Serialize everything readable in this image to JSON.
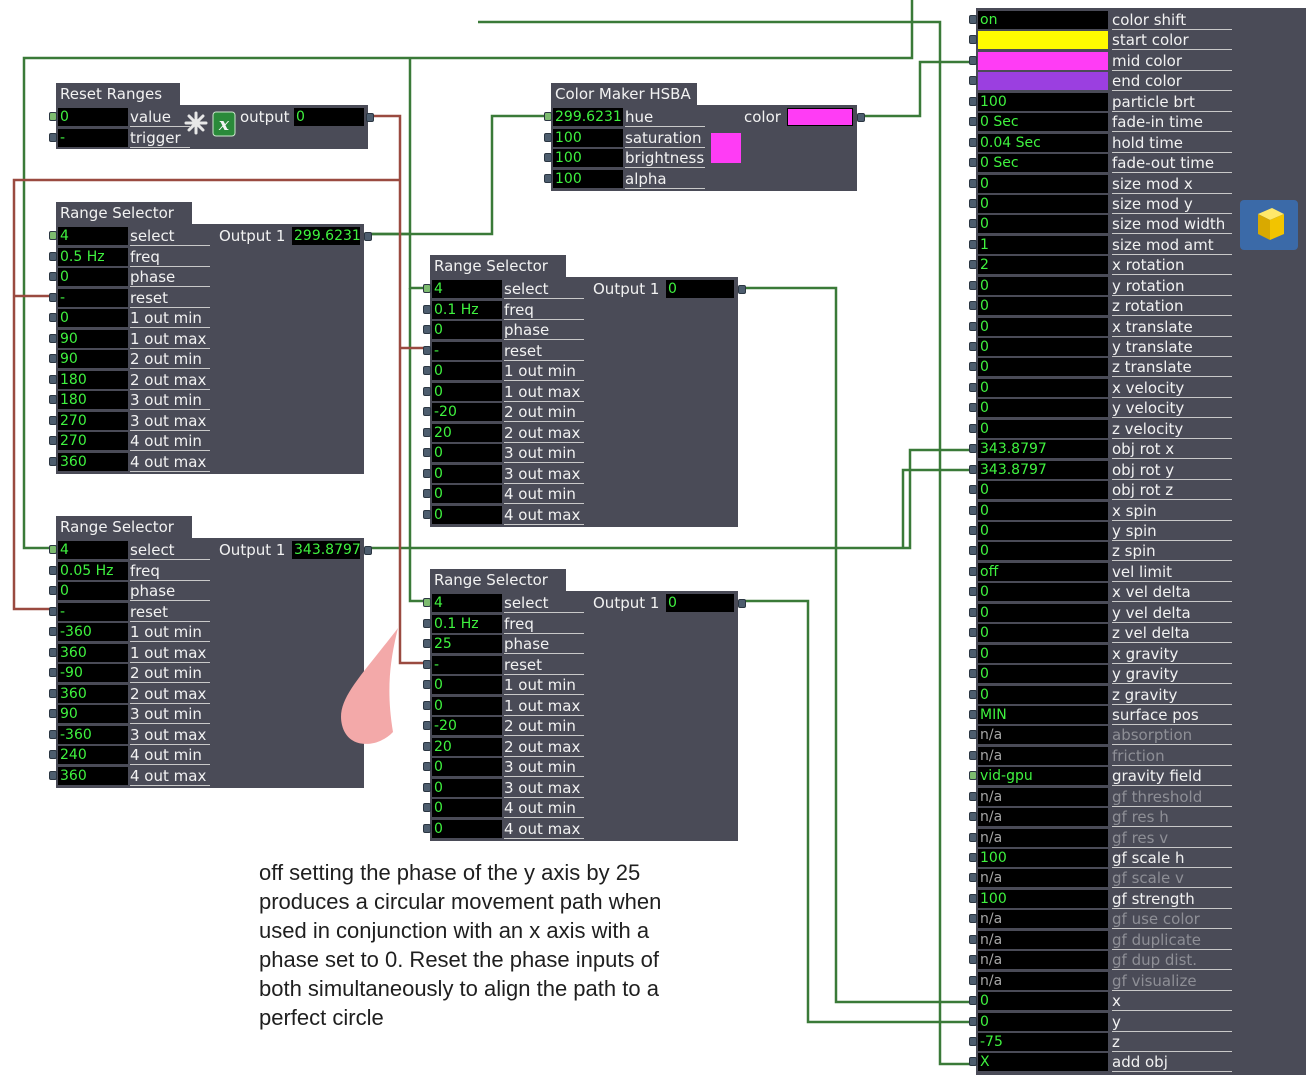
{
  "reset_ranges": {
    "title": "Reset Ranges",
    "inputs": [
      {
        "value": "0",
        "label": "value"
      },
      {
        "value": "-",
        "label": "trigger"
      }
    ],
    "output_label": "output",
    "output_value": "0"
  },
  "color_maker": {
    "title": "Color Maker HSBA",
    "inputs": [
      {
        "value": "299.6231",
        "label": "hue"
      },
      {
        "value": "100",
        "label": "saturation"
      },
      {
        "value": "100",
        "label": "brightness"
      },
      {
        "value": "100",
        "label": "alpha"
      }
    ],
    "output_label": "color",
    "swatch_color": "#ff3cf5"
  },
  "range_selector_1": {
    "title": "Range Selector",
    "output_label": "Output 1",
    "output_value": "299.6231",
    "inputs": [
      {
        "value": "4",
        "label": "select"
      },
      {
        "value": "0.5 Hz",
        "label": "freq"
      },
      {
        "value": "0",
        "label": "phase"
      },
      {
        "value": "-",
        "label": "reset"
      },
      {
        "value": "0",
        "label": "1 out min"
      },
      {
        "value": "90",
        "label": "1 out max"
      },
      {
        "value": "90",
        "label": "2 out min"
      },
      {
        "value": "180",
        "label": "2 out max"
      },
      {
        "value": "180",
        "label": "3 out min"
      },
      {
        "value": "270",
        "label": "3 out max"
      },
      {
        "value": "270",
        "label": "4 out min"
      },
      {
        "value": "360",
        "label": "4 out max"
      }
    ]
  },
  "range_selector_2": {
    "title": "Range Selector",
    "output_label": "Output 1",
    "output_value": "343.8797",
    "inputs": [
      {
        "value": "4",
        "label": "select"
      },
      {
        "value": "0.05 Hz",
        "label": "freq"
      },
      {
        "value": "0",
        "label": "phase"
      },
      {
        "value": "-",
        "label": "reset"
      },
      {
        "value": "-360",
        "label": "1 out min"
      },
      {
        "value": "360",
        "label": "1 out max"
      },
      {
        "value": "-90",
        "label": "2 out min"
      },
      {
        "value": "360",
        "label": "2 out max"
      },
      {
        "value": "90",
        "label": "3 out min"
      },
      {
        "value": "-360",
        "label": "3 out max"
      },
      {
        "value": "240",
        "label": "4 out min"
      },
      {
        "value": "360",
        "label": "4 out max"
      }
    ]
  },
  "range_selector_3": {
    "title": "Range Selector",
    "output_label": "Output 1",
    "output_value": "0",
    "inputs": [
      {
        "value": "4",
        "label": "select"
      },
      {
        "value": "0.1 Hz",
        "label": "freq"
      },
      {
        "value": "0",
        "label": "phase"
      },
      {
        "value": "-",
        "label": "reset"
      },
      {
        "value": "0",
        "label": "1 out min"
      },
      {
        "value": "0",
        "label": "1 out max"
      },
      {
        "value": "-20",
        "label": "2 out min"
      },
      {
        "value": "20",
        "label": "2 out max"
      },
      {
        "value": "0",
        "label": "3 out min"
      },
      {
        "value": "0",
        "label": "3 out max"
      },
      {
        "value": "0",
        "label": "4 out min"
      },
      {
        "value": "0",
        "label": "4 out max"
      }
    ]
  },
  "range_selector_4": {
    "title": "Range Selector",
    "output_label": "Output 1",
    "output_value": "0",
    "inputs": [
      {
        "value": "4",
        "label": "select"
      },
      {
        "value": "0.1 Hz",
        "label": "freq"
      },
      {
        "value": "25",
        "label": "phase"
      },
      {
        "value": "-",
        "label": "reset"
      },
      {
        "value": "0",
        "label": "1 out min"
      },
      {
        "value": "0",
        "label": "1 out max"
      },
      {
        "value": "-20",
        "label": "2 out min"
      },
      {
        "value": "20",
        "label": "2 out max"
      },
      {
        "value": "0",
        "label": "3 out min"
      },
      {
        "value": "0",
        "label": "3 out max"
      },
      {
        "value": "0",
        "label": "4 out min"
      },
      {
        "value": "0",
        "label": "4 out max"
      }
    ]
  },
  "particle_generator": {
    "inputs": [
      {
        "value": "on",
        "label": "color shift"
      },
      {
        "value": "",
        "label": "start color",
        "swatch": "#fffb00"
      },
      {
        "value": "",
        "label": "mid color",
        "swatch": "#ff3cf5"
      },
      {
        "value": "",
        "label": "end color",
        "swatch": "#9b3fe0"
      },
      {
        "value": "100",
        "label": "particle brt"
      },
      {
        "value": "0 Sec",
        "label": "fade-in time"
      },
      {
        "value": "0.04 Sec",
        "label": "hold time"
      },
      {
        "value": "0 Sec",
        "label": "fade-out time"
      },
      {
        "value": "0",
        "label": "size mod x"
      },
      {
        "value": "0",
        "label": "size mod y"
      },
      {
        "value": "0",
        "label": "size mod width"
      },
      {
        "value": "1",
        "label": "size mod amt"
      },
      {
        "value": "2",
        "label": "x rotation"
      },
      {
        "value": "0",
        "label": "y rotation"
      },
      {
        "value": "0",
        "label": "z rotation"
      },
      {
        "value": "0",
        "label": "x translate"
      },
      {
        "value": "0",
        "label": "y translate"
      },
      {
        "value": "0",
        "label": "z translate"
      },
      {
        "value": "0",
        "label": "x velocity"
      },
      {
        "value": "0",
        "label": "y velocity"
      },
      {
        "value": "0",
        "label": "z velocity"
      },
      {
        "value": "343.8797",
        "label": "obj rot x"
      },
      {
        "value": "343.8797",
        "label": "obj rot y"
      },
      {
        "value": "0",
        "label": "obj rot z"
      },
      {
        "value": "0",
        "label": "x spin"
      },
      {
        "value": "0",
        "label": "y spin"
      },
      {
        "value": "0",
        "label": "z spin"
      },
      {
        "value": "off",
        "label": "vel limit"
      },
      {
        "value": "0",
        "label": "x vel delta"
      },
      {
        "value": "0",
        "label": "y vel delta"
      },
      {
        "value": "0",
        "label": "z vel delta"
      },
      {
        "value": "0",
        "label": "x gravity"
      },
      {
        "value": "0",
        "label": "y gravity"
      },
      {
        "value": "0",
        "label": "z gravity"
      },
      {
        "value": "MIN",
        "label": "surface pos"
      },
      {
        "value": "n/a",
        "label": "absorption",
        "disabled": true
      },
      {
        "value": "n/a",
        "label": "friction",
        "disabled": true
      },
      {
        "value": "vid-gpu",
        "label": "gravity field"
      },
      {
        "value": "n/a",
        "label": "gf threshold",
        "disabled": true
      },
      {
        "value": "n/a",
        "label": "gf res h",
        "disabled": true
      },
      {
        "value": "n/a",
        "label": "gf res v",
        "disabled": true
      },
      {
        "value": "100",
        "label": "gf scale h"
      },
      {
        "value": "n/a",
        "label": "gf scale v",
        "disabled": true
      },
      {
        "value": "100",
        "label": "gf strength"
      },
      {
        "value": "n/a",
        "label": "gf use color",
        "disabled": true
      },
      {
        "value": "n/a",
        "label": "gf duplicate",
        "disabled": true
      },
      {
        "value": "n/a",
        "label": "gf dup dist.",
        "disabled": true
      },
      {
        "value": "n/a",
        "label": "gf visualize",
        "disabled": true
      },
      {
        "value": "0",
        "label": "x"
      },
      {
        "value": "0",
        "label": "y"
      },
      {
        "value": "-75",
        "label": "z"
      },
      {
        "value": "X",
        "label": "add obj"
      }
    ]
  },
  "note": {
    "text": "off setting the phase of the y axis by 25 produces a circular movement path when used in conjunction with an x axis with a phase set to 0. Reset  the phase inputs of both simultaneously to align the path to a perfect circle"
  },
  "colors": {
    "actor_bg": "#4a4b57",
    "value_text": "#3ff23f",
    "wire_green": "#3a7a38",
    "wire_red": "#9a4a40"
  },
  "icons": [
    "pattern-icon",
    "javascript-x-icon",
    "cube-icon",
    "speech-bubble-icon"
  ]
}
